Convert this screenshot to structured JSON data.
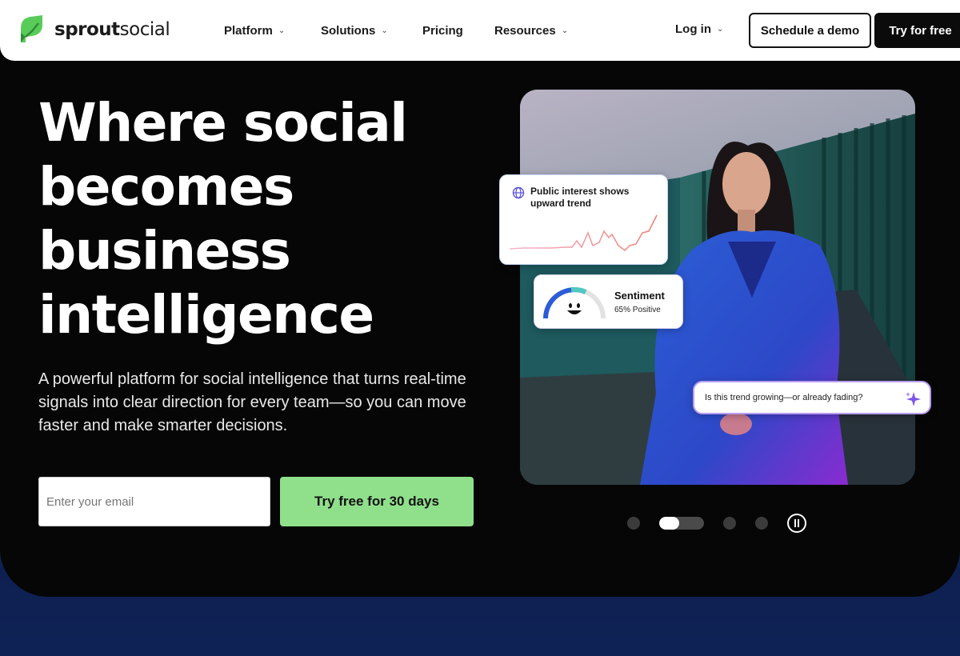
{
  "brand": {
    "logo_bold": "sprout",
    "logo_light": "social",
    "logo_color": "#59cb59"
  },
  "nav": {
    "items": [
      {
        "label": "Platform",
        "has_dropdown": true
      },
      {
        "label": "Solutions",
        "has_dropdown": true
      },
      {
        "label": "Pricing",
        "has_dropdown": false
      },
      {
        "label": "Resources",
        "has_dropdown": true
      }
    ],
    "login_label": "Log in",
    "demo_label": "Schedule a demo",
    "try_label": "Try for free"
  },
  "hero": {
    "headline_lines": [
      "Where social",
      "becomes",
      "business",
      "intelligence"
    ],
    "subcopy": "A powerful platform for social intelligence that turns real-time signals into clear direction for every team—so you can move faster and make smarter decisions.",
    "email_placeholder": "Enter your email",
    "cta_label": "Try free for 30 days",
    "cta_color": "#8fdf8b"
  },
  "cards": {
    "trend_title": "Public interest shows upward trend",
    "sentiment_title": "Sentiment",
    "sentiment_value": "65% Positive",
    "sentiment_positive_fraction": 0.65,
    "question": "Is this trend growing—or already fading?"
  },
  "carousel": {
    "slide_count": 4,
    "active_slide_index": 1,
    "active_progress_fraction": 0.45
  },
  "icons": [
    "globe-icon",
    "smile-icon",
    "sparkle-icon",
    "pause-icon",
    "chevron-down-icon"
  ]
}
